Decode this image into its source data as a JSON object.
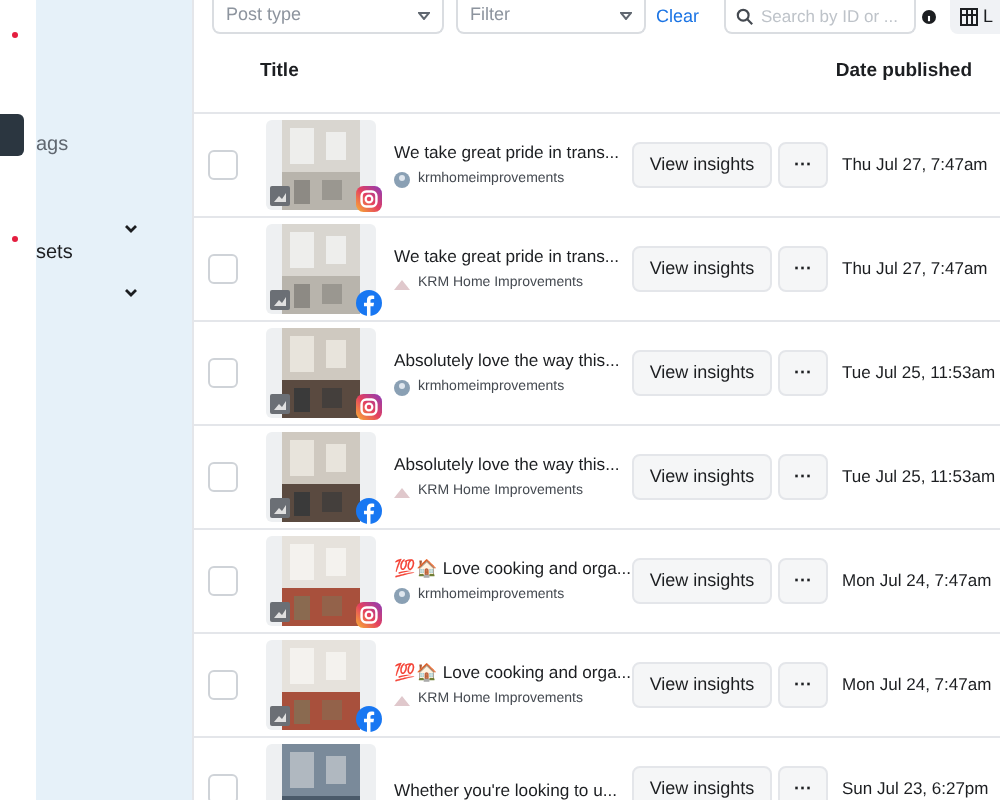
{
  "sidebar": {
    "items": [
      {
        "label": "ags",
        "selected": true
      },
      {
        "label": "sets",
        "selected": false
      }
    ]
  },
  "filters": {
    "post_type": {
      "placeholder": "Post type"
    },
    "filter": {
      "placeholder": "Filter"
    },
    "clear": "Clear",
    "search": {
      "placeholder": "Search by ID or ..."
    },
    "columns_button": "L"
  },
  "table": {
    "columns": [
      "Title",
      "Date published"
    ],
    "rows": [
      {
        "checked": false,
        "title": "We take great pride in trans...",
        "author": "krmhomeimprovements",
        "kind": "instagram",
        "date": "Thu Jul 27, 7:47am",
        "action": "View insights",
        "more": "···"
      },
      {
        "checked": false,
        "title": "We take great pride in trans...",
        "author": "KRM Home Improvements",
        "kind": "facebook",
        "date": "Thu Jul 27, 7:47am",
        "action": "View insights",
        "more": "···"
      },
      {
        "checked": false,
        "title": "Absolutely love the way this...",
        "author": "krmhomeimprovements",
        "kind": "instagram",
        "date": "Tue Jul 25, 11:53am",
        "action": "View insights",
        "more": "···"
      },
      {
        "checked": false,
        "title": "Absolutely love the way this...",
        "author": "KRM Home Improvements",
        "kind": "facebook",
        "date": "Tue Jul 25, 11:53am",
        "action": "View insights",
        "more": "···"
      },
      {
        "checked": false,
        "title": "💯🏠 Love cooking and orga...",
        "author": "krmhomeimprovements",
        "kind": "instagram",
        "date": "Mon Jul 24, 7:47am",
        "action": "View insights",
        "more": "···"
      },
      {
        "checked": false,
        "title": "💯🏠 Love cooking and orga...",
        "author": "KRM Home Improvements",
        "kind": "facebook",
        "date": "Mon Jul 24, 7:47am",
        "action": "View insights",
        "more": "···"
      },
      {
        "checked": false,
        "title": "Whether you're looking to u...",
        "date": "Sun Jul 23, 6:27pm",
        "action": "View insights",
        "more": "···"
      }
    ]
  }
}
